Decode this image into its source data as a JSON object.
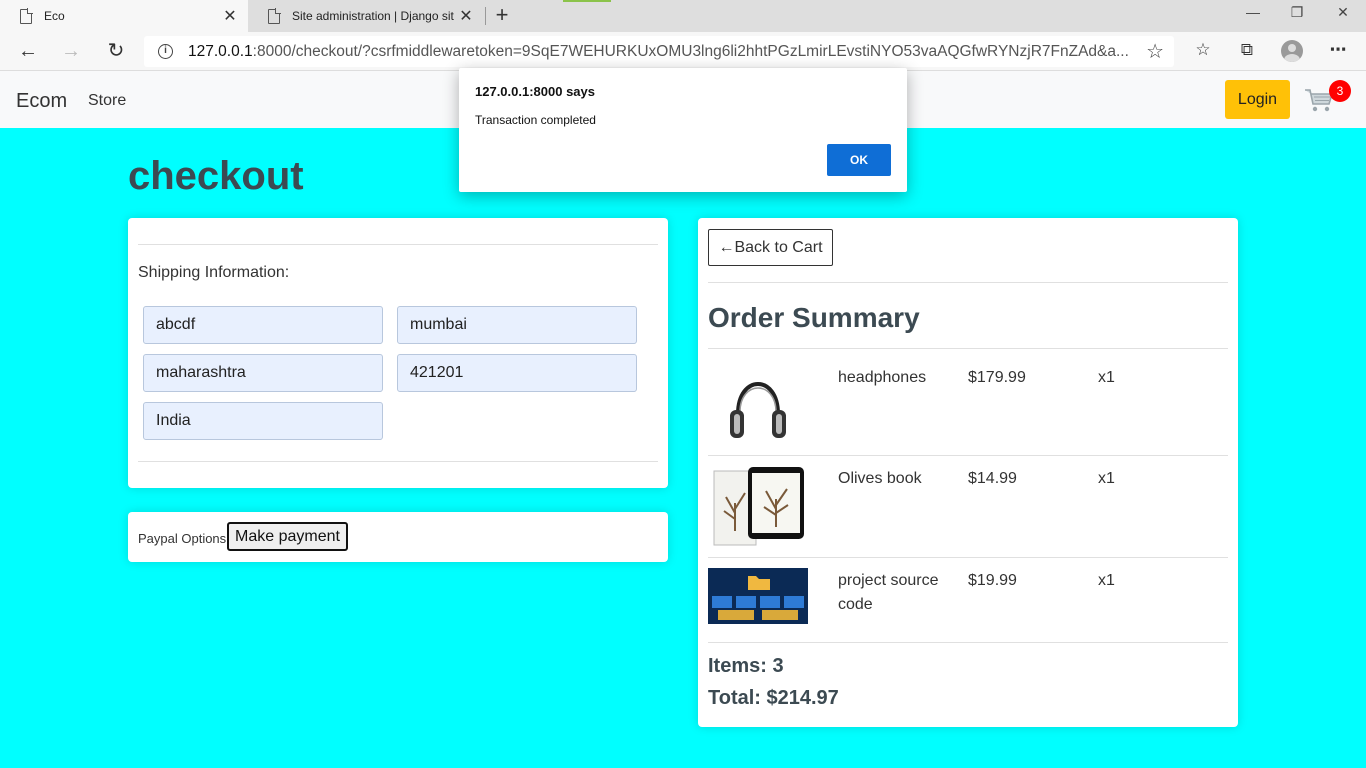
{
  "browser": {
    "tabs": [
      {
        "title": "Eco",
        "close": "✕"
      },
      {
        "title": "Site administration | Django site",
        "close": "✕"
      }
    ],
    "new_tab": "+",
    "url_host": "127.0.0.1",
    "url_rest": ":8000/checkout/?csrfmiddlewaretoken=9SqE7WEHURKUxOMU3lng6li2hhtPGzLmirLEvstiNYO53vaAQGfwRYNzjR7FnZAd&a...",
    "window": {
      "minimize": "—",
      "restore": "❐",
      "close": "✕"
    }
  },
  "navbar": {
    "brand": "Ecom",
    "store": "Store",
    "login": "Login",
    "cart_count": "3"
  },
  "page": {
    "title": "checkout"
  },
  "shipping": {
    "label": "Shipping Information:",
    "address": "abcdf",
    "city": "mumbai",
    "state": "maharashtra",
    "zipcode": "421201",
    "country": "India"
  },
  "payment": {
    "label": "Paypal Options",
    "button": "Make payment"
  },
  "summary": {
    "back": "←Back to Cart",
    "title": "Order Summary",
    "items": [
      {
        "name": "headphones",
        "price": "$179.99",
        "qty": "x1"
      },
      {
        "name": "Olives book",
        "price": "$14.99",
        "qty": "x1"
      },
      {
        "name": "project source code",
        "price": "$19.99",
        "qty": "x1"
      }
    ],
    "items_total": "Items: 3",
    "total": "Total: $214.97"
  },
  "dialog": {
    "title": "127.0.0.1:8000 says",
    "message": "Transaction completed",
    "ok": "OK"
  },
  "colors": {
    "page_bg": "#00ffff",
    "login_bg": "#ffc107",
    "badge_bg": "#ff0000",
    "ok_bg": "#0f6ed6"
  }
}
